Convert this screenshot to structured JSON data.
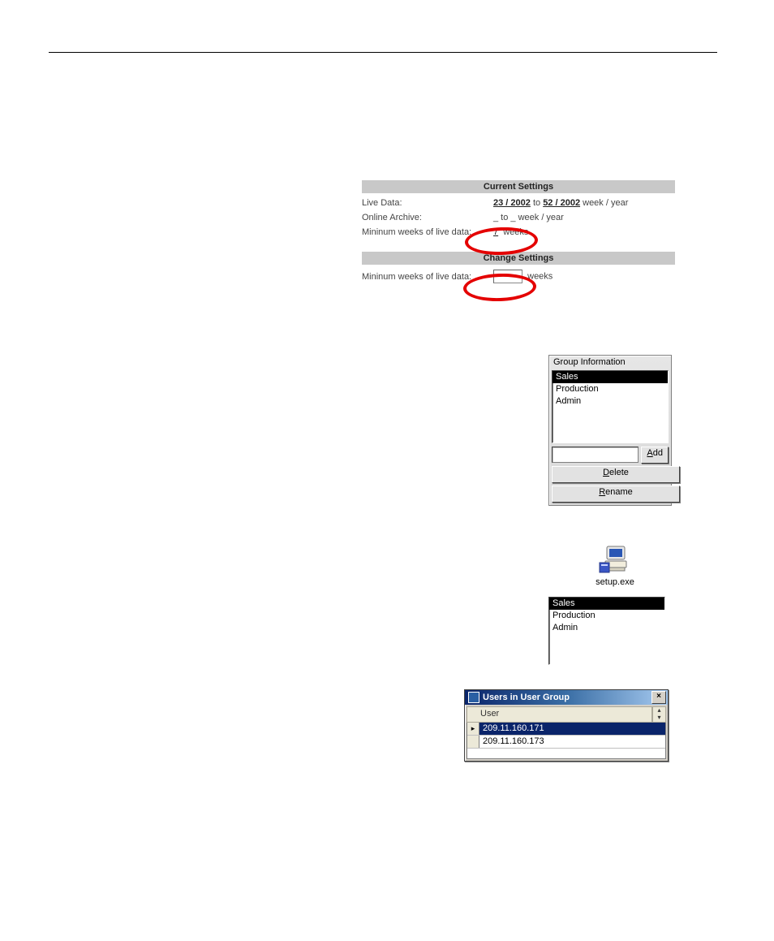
{
  "settings": {
    "header1": "Current Settings",
    "live_data_label": "Live Data:",
    "live_from": "23 / 2002",
    "live_to_word": "to",
    "live_to": "52 / 2002",
    "live_suffix": "week / year",
    "online_archive_label": "Online Archive:",
    "online_archive_value": "_ to _ week / year",
    "min_weeks_label": "Mininum weeks of live data:",
    "min_weeks_value": "7",
    "weeks_word": "weeks",
    "header2": "Change Settings"
  },
  "group_info": {
    "title": "Group Information",
    "items": [
      "Sales",
      "Production",
      "Admin"
    ],
    "add_label_pre": "",
    "add_mnemonic": "A",
    "add_label_post": "dd",
    "delete_mnemonic": "D",
    "delete_post": "elete",
    "rename_mnemonic": "R",
    "rename_post": "ename"
  },
  "setup_label": "setup.exe",
  "listbox2": {
    "items": [
      "Sales",
      "Production",
      "Admin"
    ]
  },
  "users_window": {
    "title": "Users in User Group",
    "column": "User",
    "rows": [
      "209.11.160.171",
      "209.11.160.173"
    ]
  }
}
